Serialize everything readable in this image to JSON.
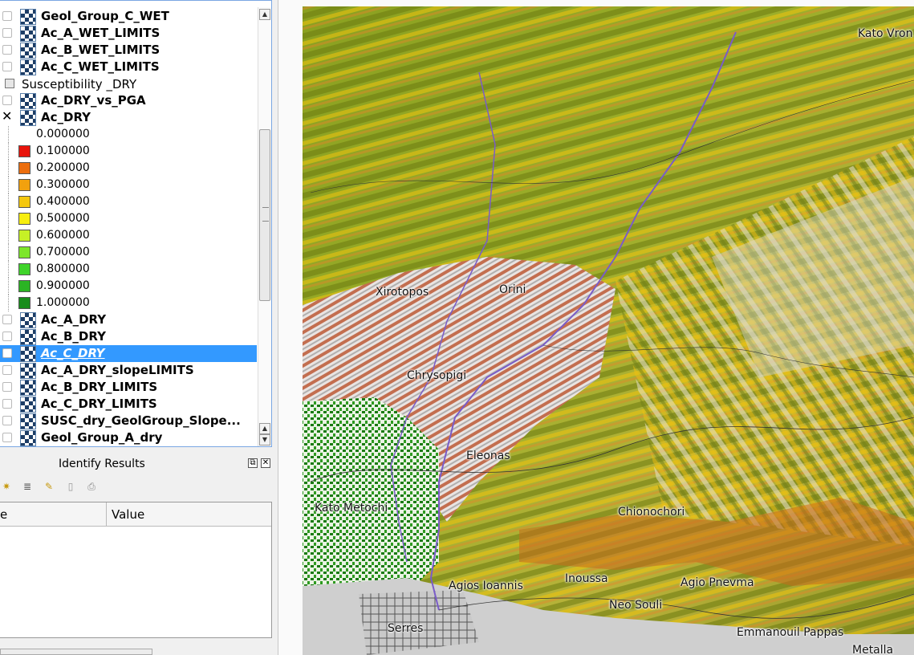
{
  "layers_panel": {
    "top_layers": [
      {
        "label": "Geol_Group_C_WET",
        "checked": false
      },
      {
        "label": "Ac_A_WET_LIMITS",
        "checked": false
      },
      {
        "label": "Ac_B_WET_LIMITS",
        "checked": false
      },
      {
        "label": "Ac_C_WET_LIMITS",
        "checked": false
      }
    ],
    "group": {
      "label": "Susceptibility _DRY"
    },
    "group_layers": [
      {
        "label": "Ac_DRY_vs_PGA",
        "checked": false
      },
      {
        "label": "Ac_DRY",
        "checked": true,
        "check_mark": "✕"
      }
    ],
    "legend": [
      {
        "value": "0.000000",
        "color": ""
      },
      {
        "value": "0.100000",
        "color": "#e8140c"
      },
      {
        "value": "0.200000",
        "color": "#ec6e0e"
      },
      {
        "value": "0.300000",
        "color": "#f2a10e"
      },
      {
        "value": "0.400000",
        "color": "#f5c80e"
      },
      {
        "value": "0.500000",
        "color": "#f7ee10"
      },
      {
        "value": "0.600000",
        "color": "#c6f026"
      },
      {
        "value": "0.700000",
        "color": "#7de62a"
      },
      {
        "value": "0.800000",
        "color": "#3fd42a"
      },
      {
        "value": "0.900000",
        "color": "#2bb424"
      },
      {
        "value": "1.000000",
        "color": "#178c1a"
      }
    ],
    "bottom_layers": [
      {
        "label": "Ac_A_DRY",
        "checked": false,
        "selected": false
      },
      {
        "label": "Ac_B_DRY",
        "checked": false,
        "selected": false
      },
      {
        "label": "Ac_C_DRY",
        "checked": false,
        "selected": true
      },
      {
        "label": "Ac_A_DRY_slopeLIMITS",
        "checked": false,
        "selected": false
      },
      {
        "label": "Ac_B_DRY_LIMITS",
        "checked": false,
        "selected": false
      },
      {
        "label": "Ac_C_DRY_LIMITS",
        "checked": false,
        "selected": false
      },
      {
        "label": "SUSC_dry_GeolGroup_Slope...",
        "checked": false,
        "selected": false
      },
      {
        "label": "Geol_Group_A_dry",
        "checked": false,
        "selected": false
      }
    ]
  },
  "identify": {
    "title": "Identify Results",
    "columns": [
      "e",
      "Value"
    ],
    "float_glyph": "⧉",
    "close_glyph": "✕"
  },
  "map": {
    "places": [
      {
        "name": "Kato Vron"
      },
      {
        "name": "Xirotopos"
      },
      {
        "name": "Orini"
      },
      {
        "name": "Chrysopigi"
      },
      {
        "name": "Eleonas"
      },
      {
        "name": "Kato Metochi"
      },
      {
        "name": "Chionochori"
      },
      {
        "name": "Agios Ioannis"
      },
      {
        "name": "Inoussa"
      },
      {
        "name": "Agio Pnevma"
      },
      {
        "name": "Neo Souli"
      },
      {
        "name": "Serres"
      },
      {
        "name": "Emmanouil Pappas"
      },
      {
        "name": "Metalla"
      }
    ]
  }
}
